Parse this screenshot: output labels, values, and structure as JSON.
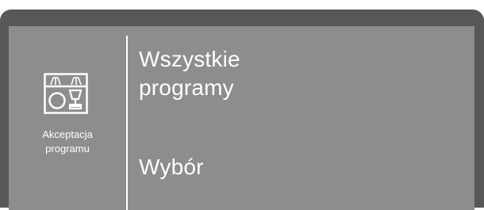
{
  "panel": {
    "icon": "program-acceptance-icon",
    "icon_label": "Akceptacja\nprogramu"
  },
  "menu": {
    "items": [
      {
        "label": "Wszystkie\nprogramy"
      },
      {
        "label": "Wybór"
      }
    ]
  },
  "colors": {
    "frame": "#575757",
    "screen": "#8c8d8f",
    "text": "#ffffff"
  }
}
